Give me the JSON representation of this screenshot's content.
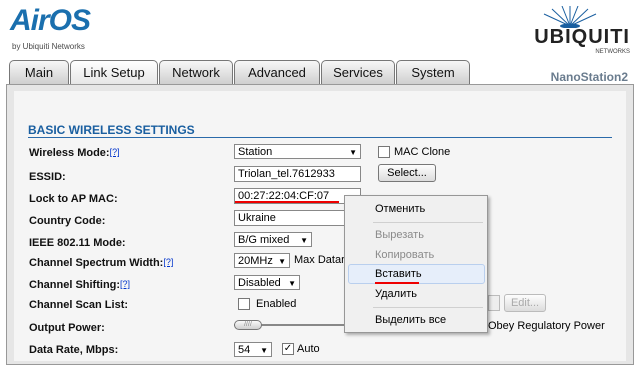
{
  "header": {
    "logo_text": "AirOS",
    "logo_sub": "by Ubiquiti Networks",
    "brand": "UBIQUITI",
    "brand_sub": "NETWORKS"
  },
  "tabs": [
    {
      "label": "Main"
    },
    {
      "label": "Link Setup"
    },
    {
      "label": "Network"
    },
    {
      "label": "Advanced"
    },
    {
      "label": "Services"
    },
    {
      "label": "System"
    }
  ],
  "device_name": "NanoStation2",
  "section_title": "BASIC WIRELESS SETTINGS",
  "help_mark": "[?]",
  "fields": {
    "wireless_mode": {
      "label": "Wireless Mode:",
      "value": "Station"
    },
    "mac_clone": {
      "label": "MAC Clone"
    },
    "essid": {
      "label": "ESSID:",
      "value": "Triolan_tel.7612933",
      "select_button": "Select..."
    },
    "lock_ap_mac": {
      "label": "Lock to AP MAC:",
      "value": "00:27:22:04:CF:07"
    },
    "country_code": {
      "label": "Country Code:",
      "value": "Ukraine"
    },
    "ieee_mode": {
      "label": "IEEE 802.11 Mode:",
      "value": "B/G mixed"
    },
    "channel_width": {
      "label": "Channel Spectrum Width:",
      "value": "20MHz",
      "max_text": "Max Datar"
    },
    "channel_shifting": {
      "label": "Channel Shifting:",
      "value": "Disabled"
    },
    "scan_list": {
      "label": "Channel Scan List:",
      "enabled_label": "Enabled",
      "edit_button": "Edit..."
    },
    "output_power": {
      "label": "Output Power:",
      "obey_text": "Obey Regulatory Power"
    },
    "data_rate": {
      "label": "Data Rate, Mbps:",
      "value": "54",
      "auto_label": "Auto"
    }
  },
  "context_menu": {
    "items": [
      "Отменить",
      "Вырезать",
      "Копировать",
      "Вставить",
      "Удалить",
      "Выделить все"
    ],
    "highlighted": "Вставить"
  },
  "colors": {
    "accent": "#1a5fa0",
    "annotation": "#e00000"
  }
}
